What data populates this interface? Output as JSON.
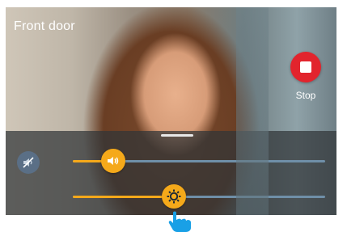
{
  "camera": {
    "label": "Front door"
  },
  "stop": {
    "label": "Stop",
    "color": "#e2242d"
  },
  "volume": {
    "level": 0.16,
    "icon": "speaker-icon",
    "mute_icon": "speaker-muted-icon"
  },
  "brightness": {
    "level": 0.4,
    "icon": "brightness-sun-icon"
  },
  "colors": {
    "accent": "#f5a91a",
    "track": "#6f8fa8",
    "mute_button": "#5a6f86"
  }
}
